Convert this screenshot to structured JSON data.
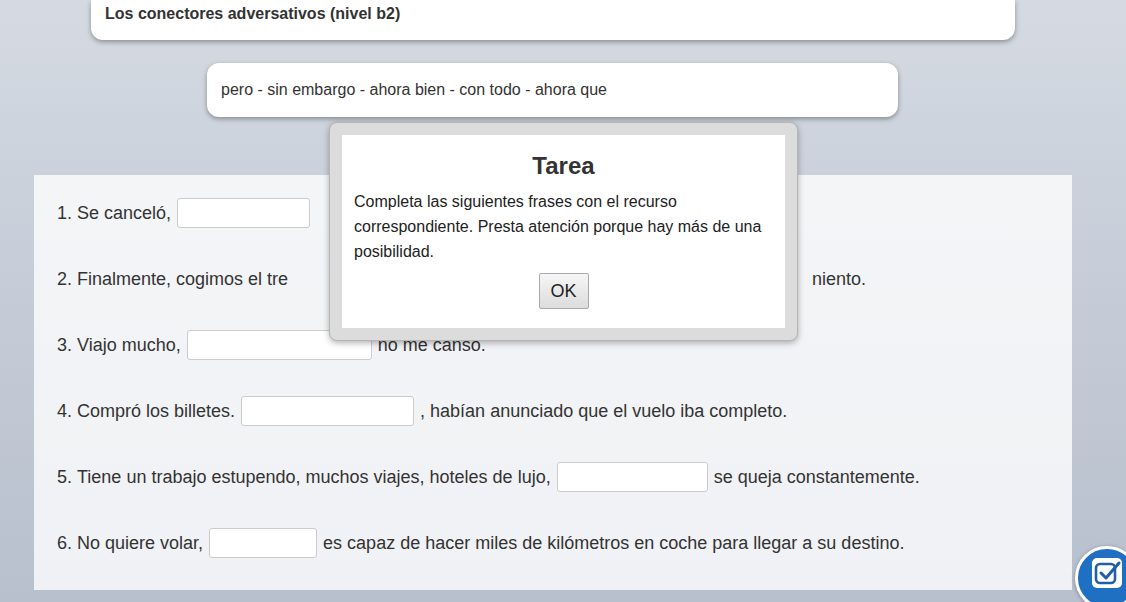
{
  "header": {
    "title": "Los conectores adversativos (nivel b2)"
  },
  "word_bank": {
    "text": "pero - sin embargo - ahora bien - con todo - ahora que"
  },
  "exercise": {
    "items": [
      {
        "kind": "blank",
        "number": "1.",
        "before": "Se canceló,",
        "value": "",
        "after": ""
      },
      {
        "kind": "covered",
        "number": "2.",
        "before": "Finalmente, cogimos el tre",
        "value": "",
        "after": "niento."
      },
      {
        "kind": "blank",
        "number": "3.",
        "before": "Viajo mucho,",
        "value": "",
        "after": "no me canso."
      },
      {
        "kind": "blank",
        "number": "4.",
        "before": "Compró los billetes.",
        "value": "",
        "after": ", habían anunciado que el vuelo iba completo."
      },
      {
        "kind": "blank",
        "number": "5.",
        "before": "Tiene un trabajo estupendo, muchos viajes, hoteles de lujo,",
        "value": "",
        "after": "se queja constantemente."
      },
      {
        "kind": "blank",
        "number": "6.",
        "before": "No quiere volar,",
        "value": "",
        "after": "es capaz de hacer miles de kilómetros en coche para llegar a su destino."
      }
    ]
  },
  "dialog": {
    "title": "Tarea",
    "message": "Completa las siguientes frases con el recurso correspondiente. Presta atención porque hay más de una posibilidad.",
    "buttons": [
      "OK"
    ]
  }
}
